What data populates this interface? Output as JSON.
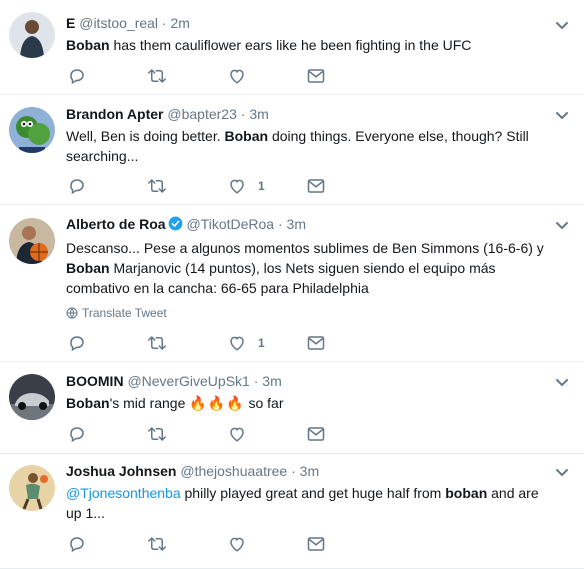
{
  "tweets": [
    {
      "fullname": "E",
      "handle": "@itstoo_real",
      "time": "2m",
      "verified": false,
      "text_parts": [
        {
          "t": "Boban",
          "b": true
        },
        {
          "t": " has them cauliflower ears like he been fighting in the UFC",
          "b": false
        }
      ],
      "likes": "",
      "translate": ""
    },
    {
      "fullname": "Brandon Apter",
      "handle": "@bapter23",
      "time": "3m",
      "verified": false,
      "text_parts": [
        {
          "t": "Well, Ben is doing better. ",
          "b": false
        },
        {
          "t": "Boban",
          "b": true
        },
        {
          "t": " doing things. Everyone else, though? Still searching...",
          "b": false
        }
      ],
      "likes": "1",
      "translate": ""
    },
    {
      "fullname": "Alberto de Roa",
      "handle": "@TikotDeRoa",
      "time": "3m",
      "verified": true,
      "text_parts": [
        {
          "t": "Descanso... Pese a algunos momentos sublimes de Ben Simmons (16-6-6) y ",
          "b": false
        },
        {
          "t": "Boban",
          "b": true
        },
        {
          "t": " Marjanovic (14 puntos), los Nets siguen siendo el equipo más combativo en la cancha: 66-65 para Philadelphia",
          "b": false
        }
      ],
      "likes": "1",
      "translate": "Translate Tweet"
    },
    {
      "fullname": "BOOMIN",
      "handle": "@NeverGiveUpSk1",
      "time": "3m",
      "verified": false,
      "text_parts": [
        {
          "t": "Boban",
          "b": true
        },
        {
          "t": "'s mid range ",
          "b": false
        },
        {
          "t": "🔥🔥🔥",
          "b": false,
          "fire": true
        },
        {
          "t": " so far",
          "b": false
        }
      ],
      "likes": "",
      "translate": ""
    },
    {
      "fullname": "Joshua Johnsen",
      "handle": "@thejoshuaatree",
      "time": "3m",
      "verified": false,
      "text_parts": [
        {
          "t": "@Tjonesonthenba",
          "b": false,
          "mention": true
        },
        {
          "t": " philly played great and get huge half from ",
          "b": false
        },
        {
          "t": "boban",
          "b": true
        },
        {
          "t": " and are up 1...",
          "b": false
        }
      ],
      "likes": "",
      "translate": ""
    }
  ],
  "icons": {
    "reply": "reply-icon",
    "retweet": "retweet-icon",
    "like": "like-icon",
    "message": "direct-message-icon",
    "caret": "chevron-down-icon",
    "verified": "verified-badge-icon",
    "globe": "globe-icon"
  },
  "colors": {
    "text": "#14171a",
    "secondary": "#657786",
    "link": "#1b95e0",
    "verified": "#1da1f2",
    "divider": "#e6ecf0"
  }
}
